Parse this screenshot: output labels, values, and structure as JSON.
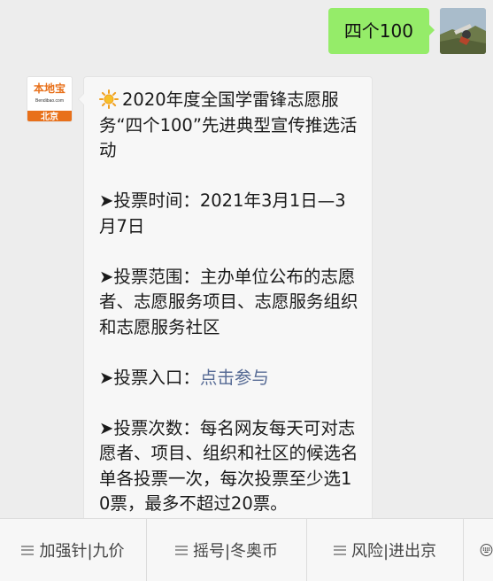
{
  "outgoing": {
    "text": "四个100"
  },
  "incoming": {
    "sender_logo_text": "本地宝",
    "sender_logo_site": "Bendibao.com",
    "sender_logo_city": "北京",
    "title_text": "2020年度全国学雷锋志愿服务“四个100”先进典型宣传推选活动",
    "vote_time": "➤投票时间：2021年3月1日—3月7日",
    "vote_scope": "➤投票范围：主办单位公布的志愿者、志愿服务项目、志愿服务组织和志愿服务社区",
    "vote_entry_label": "➤投票入口：",
    "vote_entry_link": "点击参与",
    "vote_count": "➤投票次数：每名网友每天可对志愿者、项目、组织和社区的候选名单各投票一次，每次投票至少选10票，最多不超过20票。"
  },
  "menu": {
    "items": [
      {
        "label": "加强针|九价"
      },
      {
        "label": "摇号|冬奥币"
      },
      {
        "label": "风险|进出京"
      }
    ],
    "keyboard_icon": "keyboard-icon"
  },
  "colors": {
    "outgoing_bubble": "#95ec69",
    "incoming_bubble": "#f7f7f7",
    "link": "#576b95",
    "brand_orange": "#e8701a",
    "background": "#ededed"
  }
}
